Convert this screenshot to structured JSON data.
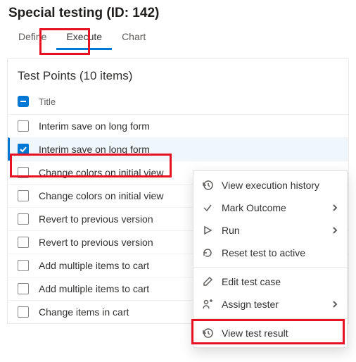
{
  "header": {
    "title": "Special testing (ID: 142)"
  },
  "tabs": {
    "items": [
      {
        "label": "Define"
      },
      {
        "label": "Execute"
      },
      {
        "label": "Chart"
      }
    ],
    "active_index": 1
  },
  "panel": {
    "title": "Test Points (10 items)",
    "column_header": "Title"
  },
  "rows": [
    {
      "title": "Interim save on long form",
      "checked": false
    },
    {
      "title": "Interim save on long form",
      "checked": true
    },
    {
      "title": "Change colors on initial view",
      "checked": false
    },
    {
      "title": "Change colors on initial view",
      "checked": false
    },
    {
      "title": "Revert to previous version",
      "checked": false
    },
    {
      "title": "Revert to previous version",
      "checked": false
    },
    {
      "title": "Add multiple items to cart",
      "checked": false
    },
    {
      "title": "Add multiple items to cart",
      "checked": false
    },
    {
      "title": "Change items in cart",
      "checked": false
    }
  ],
  "menu": {
    "items": [
      {
        "label": "View execution history",
        "submenu": false,
        "icon": "history"
      },
      {
        "label": "Mark Outcome",
        "submenu": true,
        "icon": "check"
      },
      {
        "label": "Run",
        "submenu": true,
        "icon": "play"
      },
      {
        "label": "Reset test to active",
        "submenu": false,
        "icon": "reset"
      },
      {
        "label": "Edit test case",
        "submenu": false,
        "icon": "edit"
      },
      {
        "label": "Assign tester",
        "submenu": true,
        "icon": "assign"
      },
      {
        "label": "View test result",
        "submenu": false,
        "icon": "history"
      }
    ]
  }
}
